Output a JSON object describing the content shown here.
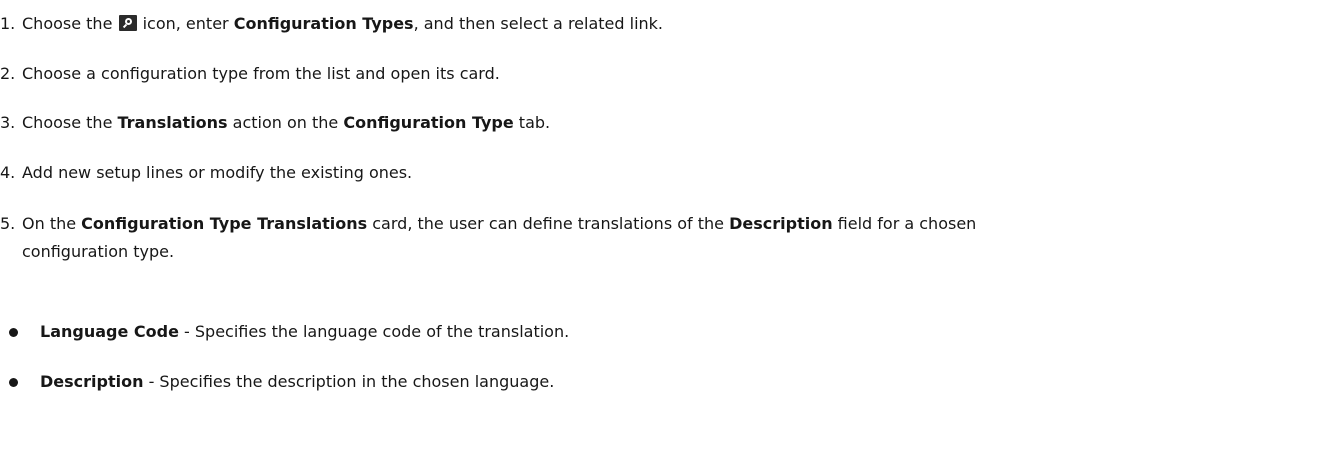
{
  "steps": [
    {
      "number": "1.",
      "before_icon": "Choose the ",
      "icon": "search-icon",
      "after_icon": " icon, enter ",
      "bold1": "Configuration Types",
      "after_bold1": ", and then select a related link."
    },
    {
      "number": "2.",
      "text": "Choose a configuration type from the list and open its card."
    },
    {
      "number": "3.",
      "t1": "Choose the ",
      "bold1": "Translations",
      "t2": " action on the ",
      "bold2": "Configuration Type",
      "t3": " tab."
    },
    {
      "number": "4.",
      "text": "Add new setup lines or modify the existing ones."
    },
    {
      "number": "5.",
      "t1": "On the ",
      "bold1": "Configuration Type Translations",
      "t2": " card, the user can define translations of the ",
      "bold2": "Description",
      "t3": " field for a chosen",
      "t4": "configuration type."
    }
  ],
  "fields": [
    {
      "name": "Language Code",
      "description": " - Specifies the language code of the translation."
    },
    {
      "name": "Description",
      "description": " - Specifies the description in the chosen language."
    }
  ]
}
